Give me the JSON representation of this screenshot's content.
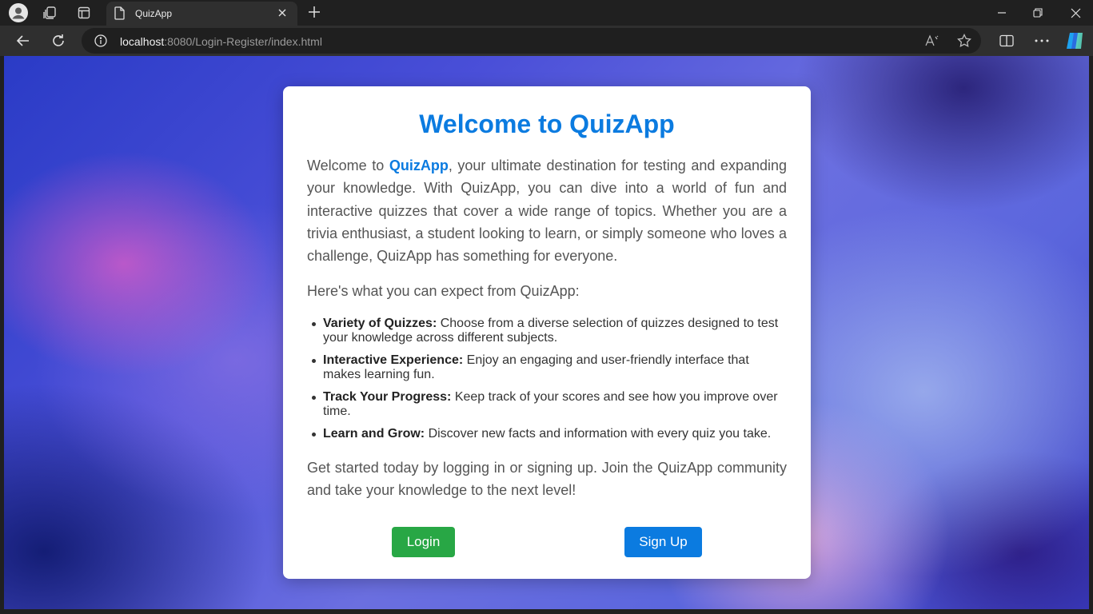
{
  "browser": {
    "tab_title": "QuizApp",
    "address": {
      "host": "localhost",
      "rest": ":8080/Login-Register/index.html"
    }
  },
  "page": {
    "title": "Welcome to QuizApp",
    "intro": {
      "before": "Welcome to ",
      "brand": "QuizApp",
      "after": ", your ultimate destination for testing and expanding your knowledge. With QuizApp, you can dive into a world of fun and interactive quizzes that cover a wide range of topics. Whether you are a trivia enthusiast, a student looking to learn, or simply someone who loves a challenge, QuizApp has something for everyone."
    },
    "expect": "Here's what you can expect from QuizApp:",
    "features": [
      {
        "title": "Variety of Quizzes:",
        "text": " Choose from a diverse selection of quizzes designed to test your knowledge across different subjects."
      },
      {
        "title": "Interactive Experience:",
        "text": " Enjoy an engaging and user-friendly interface that makes learning fun."
      },
      {
        "title": "Track Your Progress:",
        "text": " Keep track of your scores and see how you improve over time."
      },
      {
        "title": "Learn and Grow:",
        "text": " Discover new facts and information with every quiz you take."
      }
    ],
    "outro": "Get started today by logging in or signing up. Join the QuizApp community and take your knowledge to the next level!",
    "login_label": "Login",
    "signup_label": "Sign Up"
  },
  "colors": {
    "brand_blue": "#0b7be0",
    "login_green": "#28a745"
  }
}
